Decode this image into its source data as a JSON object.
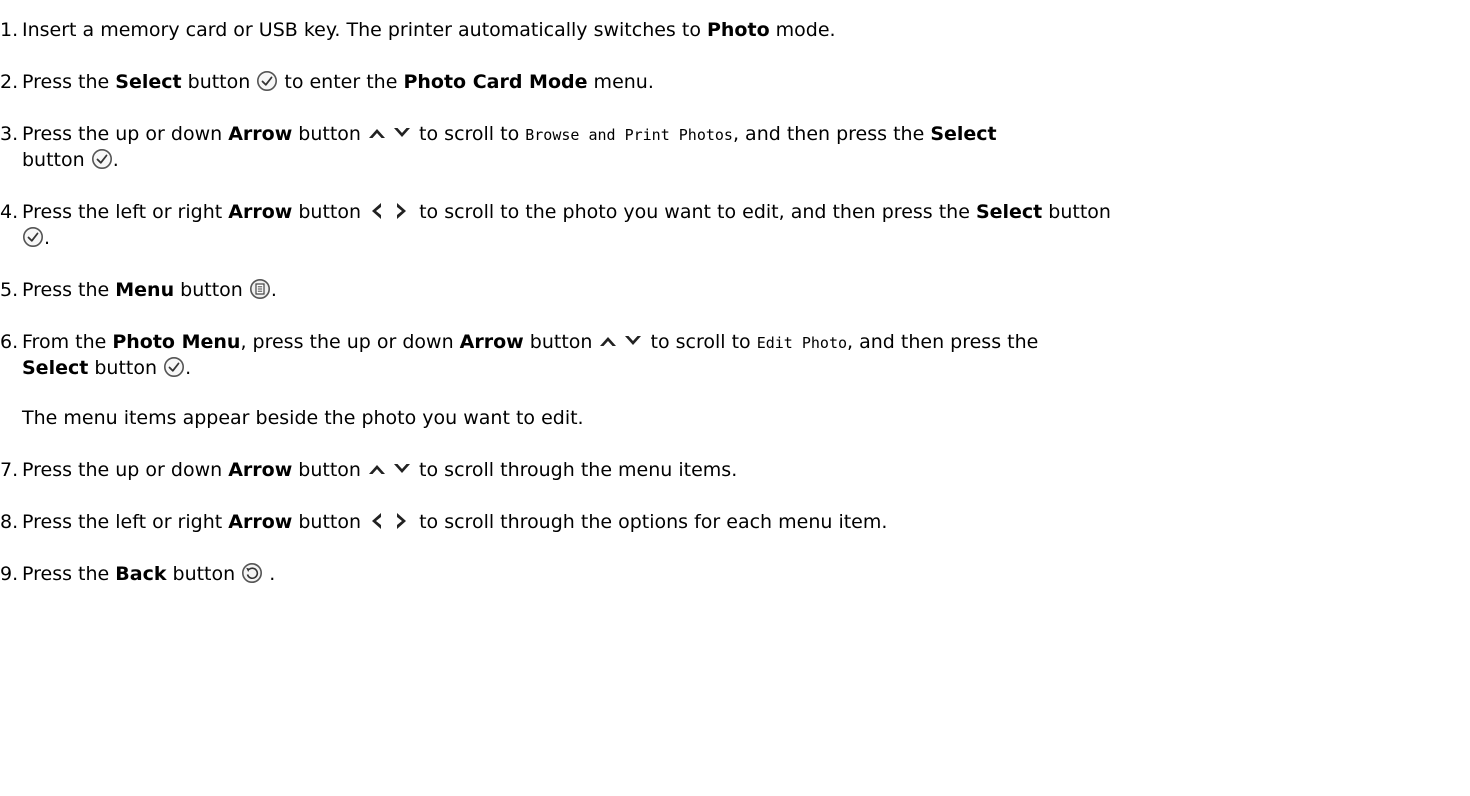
{
  "steps": [
    {
      "num": "1.",
      "a": "Insert a memory card or USB key. The printer automatically switches to ",
      "b": "Photo",
      "c": " mode."
    },
    {
      "num": "2.",
      "a": "Press the ",
      "b": "Select",
      "c": " button ",
      "d": " to enter the ",
      "e": "Photo Card Mode",
      "f": " menu."
    },
    {
      "num": "3.",
      "a": "Press the up or down ",
      "b": "Arrow",
      "c": " button ",
      "d": " to scroll to ",
      "mono": "Browse and Print Photos",
      "e": ", and then press the ",
      "f": "Select",
      "g": "button ",
      "h": "."
    },
    {
      "num": "4.",
      "a": "Press the left or right ",
      "b": "Arrow",
      "c": " button ",
      "d": " to scroll to the photo you want to edit, and then press the ",
      "e": "Select",
      "f": " button",
      "g": "."
    },
    {
      "num": "5.",
      "a": "Press the ",
      "b": "Menu",
      "c": " button ",
      "d": "."
    },
    {
      "num": "6.",
      "a": "From the ",
      "b": "Photo Menu",
      "c": ", press the up or down ",
      "d": "Arrow",
      "e": " button ",
      "f": " to scroll to ",
      "mono": "Edit Photo",
      "g": ", and then press the",
      "h": "Select",
      "i": " button ",
      "j": "."
    },
    {
      "note": "The menu items appear beside the photo you want to edit."
    },
    {
      "num": "7.",
      "a": "Press the up or down ",
      "b": "Arrow",
      "c": " button ",
      "d": " to scroll through the menu items."
    },
    {
      "num": "8.",
      "a": "Press the left or right ",
      "b": "Arrow",
      "c": " button ",
      "d": " to scroll through the options for each menu item."
    },
    {
      "num": "9.",
      "a": "Press the ",
      "b": "Back",
      "c": " button ",
      "d": " ."
    }
  ]
}
